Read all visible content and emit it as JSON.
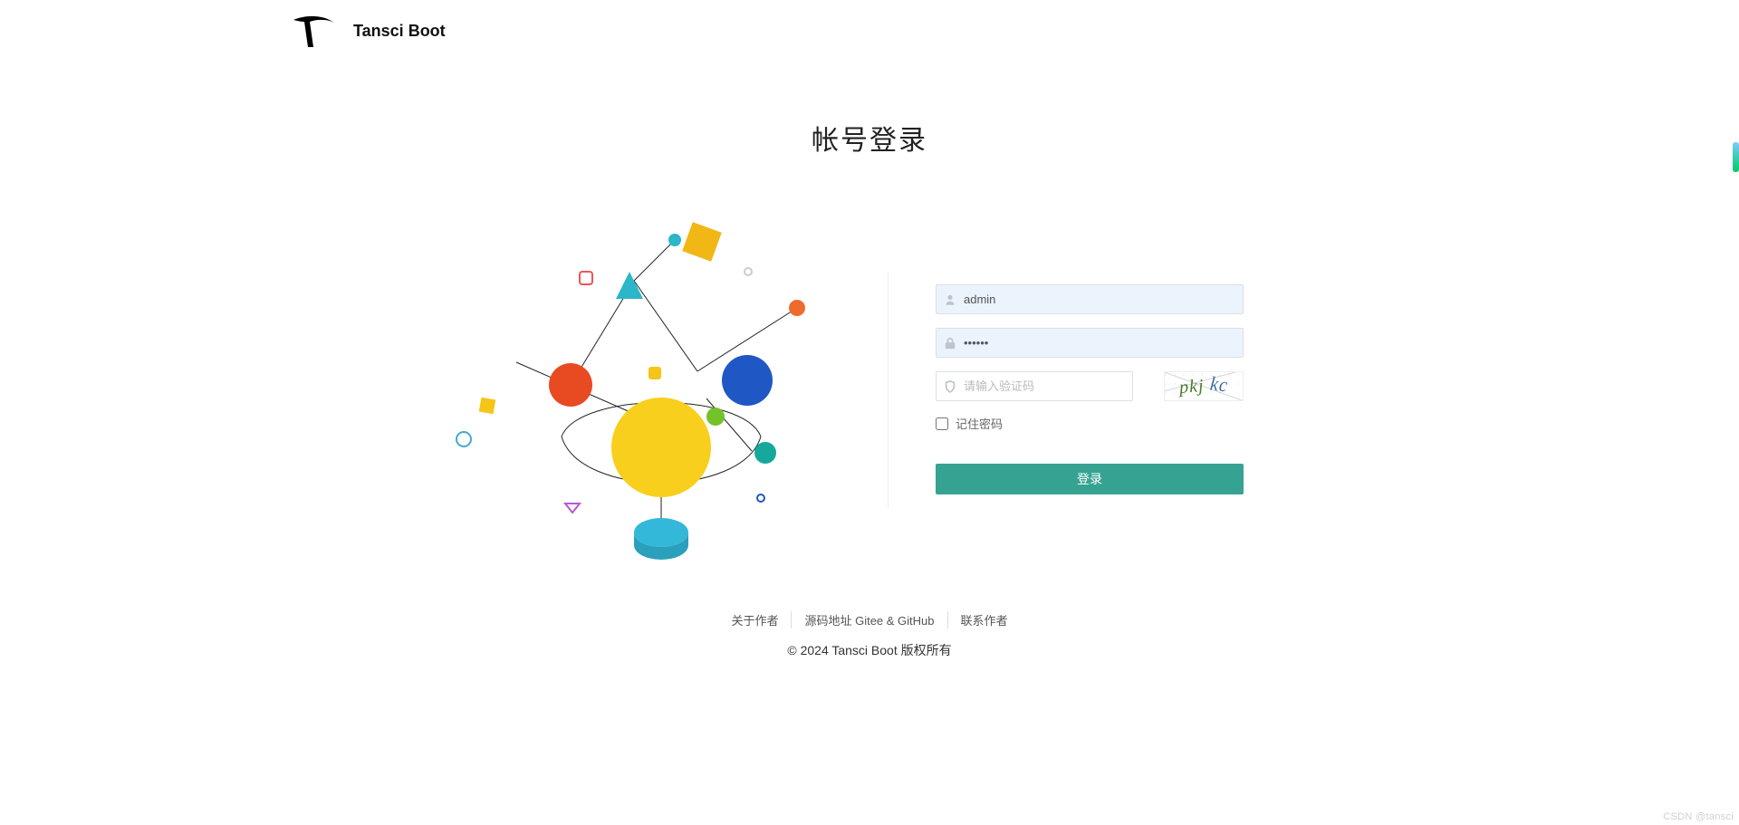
{
  "brand": {
    "name": "Tansci Boot"
  },
  "title": "帐号登录",
  "form": {
    "username_value": "admin",
    "password_value": "••••••",
    "captcha_placeholder": "请输入验证码",
    "captcha_text_a": "pkj",
    "captcha_text_b": "kc",
    "remember_label": "记住密码",
    "login_label": "登录"
  },
  "footer": {
    "about": "关于作者",
    "source": "源码地址 Gitee & GitHub",
    "contact": "联系作者",
    "copyright": "© 2024 Tansci Boot 版权所有"
  },
  "watermark": "CSDN @tansci"
}
